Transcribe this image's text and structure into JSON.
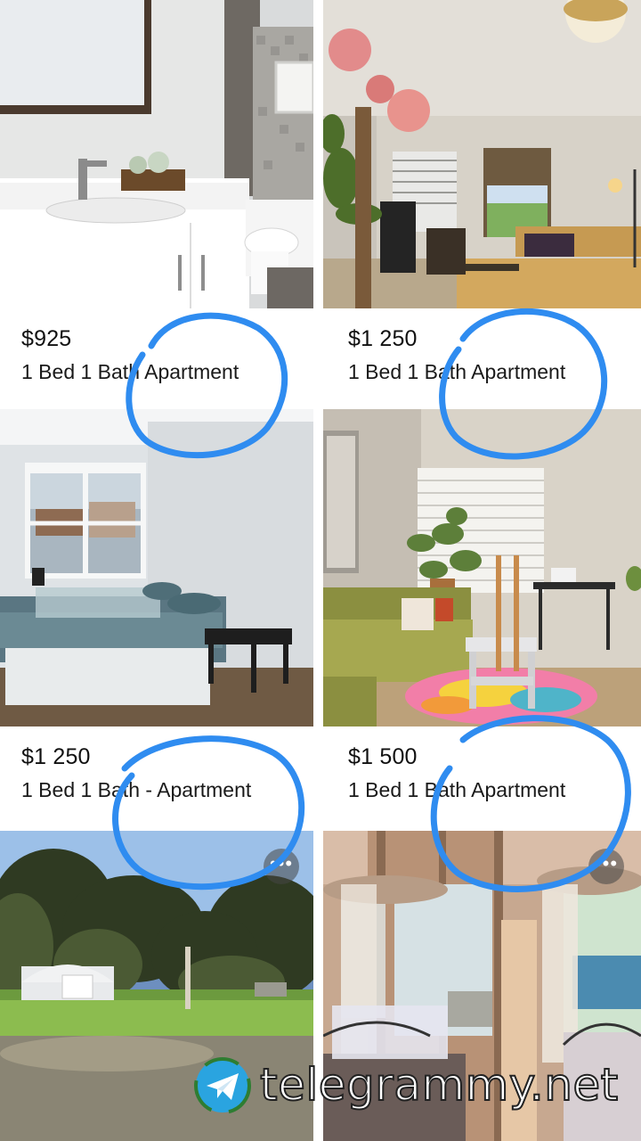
{
  "listings": [
    {
      "price": "$925",
      "title": "1 Bed 1 Bath Apartment",
      "photo": "bathroom-photo"
    },
    {
      "price": "$1 250",
      "title": "1 Bed 1 Bath Apartment",
      "photo": "living-room-photo"
    },
    {
      "price": "$1 250",
      "title": "1 Bed 1 Bath - Apartment",
      "photo": "bedroom-photo"
    },
    {
      "price": "$1 500",
      "title": "1 Bed 1 Bath Apartment",
      "photo": "sunlit-living-room-photo"
    },
    {
      "photo": "yard-with-garage-photo",
      "more": "•••"
    },
    {
      "photo": "bedroom-mirror-closet-photo",
      "more": "•••"
    }
  ],
  "watermark": {
    "text": "telegrammy.net",
    "icon": "telegram-paper-plane-icon"
  },
  "annotation_color": "#2f8cf0",
  "colors": {
    "background": "#ffffff",
    "text": "#111111"
  }
}
